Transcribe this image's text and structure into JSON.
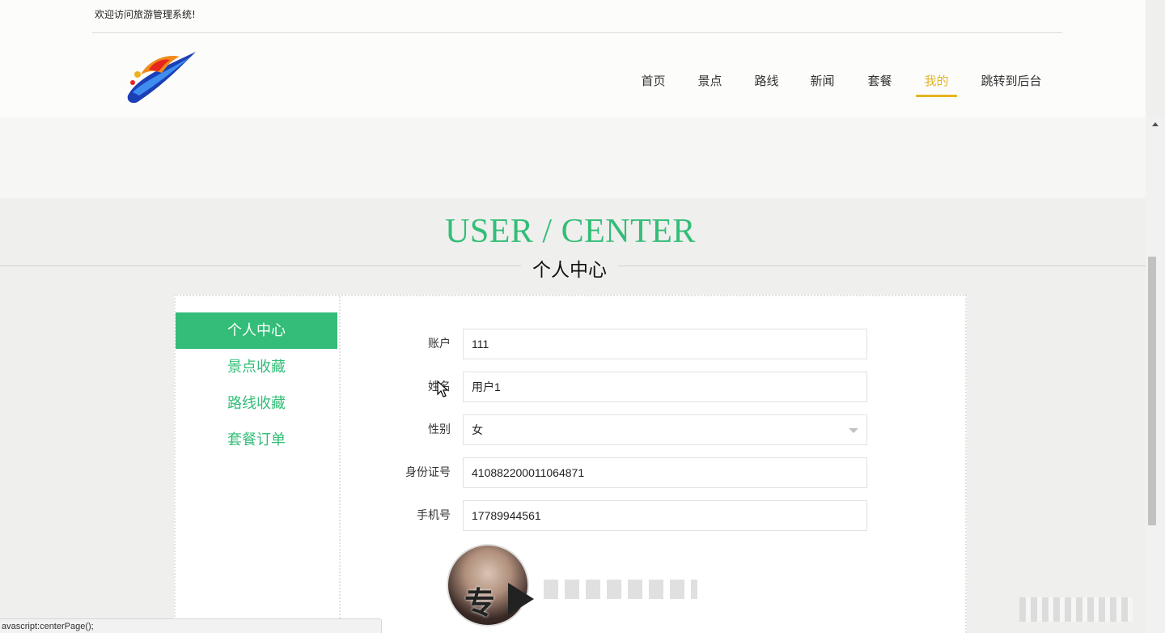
{
  "header": {
    "welcome": "欢迎访问旅游管理系统!",
    "nav": [
      {
        "label": "首页"
      },
      {
        "label": "景点"
      },
      {
        "label": "路线"
      },
      {
        "label": "新闻"
      },
      {
        "label": "套餐"
      },
      {
        "label": "我的",
        "active": true
      },
      {
        "label": "跳转到后台"
      }
    ]
  },
  "section": {
    "title_en": "USER / CENTER",
    "title_cn": "个人中心"
  },
  "sidebar": {
    "items": [
      {
        "label": "个人中心",
        "active": true
      },
      {
        "label": "景点收藏"
      },
      {
        "label": "路线收藏"
      },
      {
        "label": "套餐订单"
      }
    ]
  },
  "form": {
    "account": {
      "label": "账户",
      "value": "111"
    },
    "name": {
      "label": "姓名",
      "value": "用户1"
    },
    "gender": {
      "label": "性别",
      "value": "女"
    },
    "idcard": {
      "label": "身份证号",
      "value": "410882200011064871"
    },
    "phone": {
      "label": "手机号",
      "value": "17789944561"
    }
  },
  "overlay": {
    "avatar_text": "专"
  },
  "statusbar": {
    "text": "avascript:centerPage();"
  },
  "colors": {
    "accent": "#33bd78",
    "nav_active": "#e5b522"
  }
}
